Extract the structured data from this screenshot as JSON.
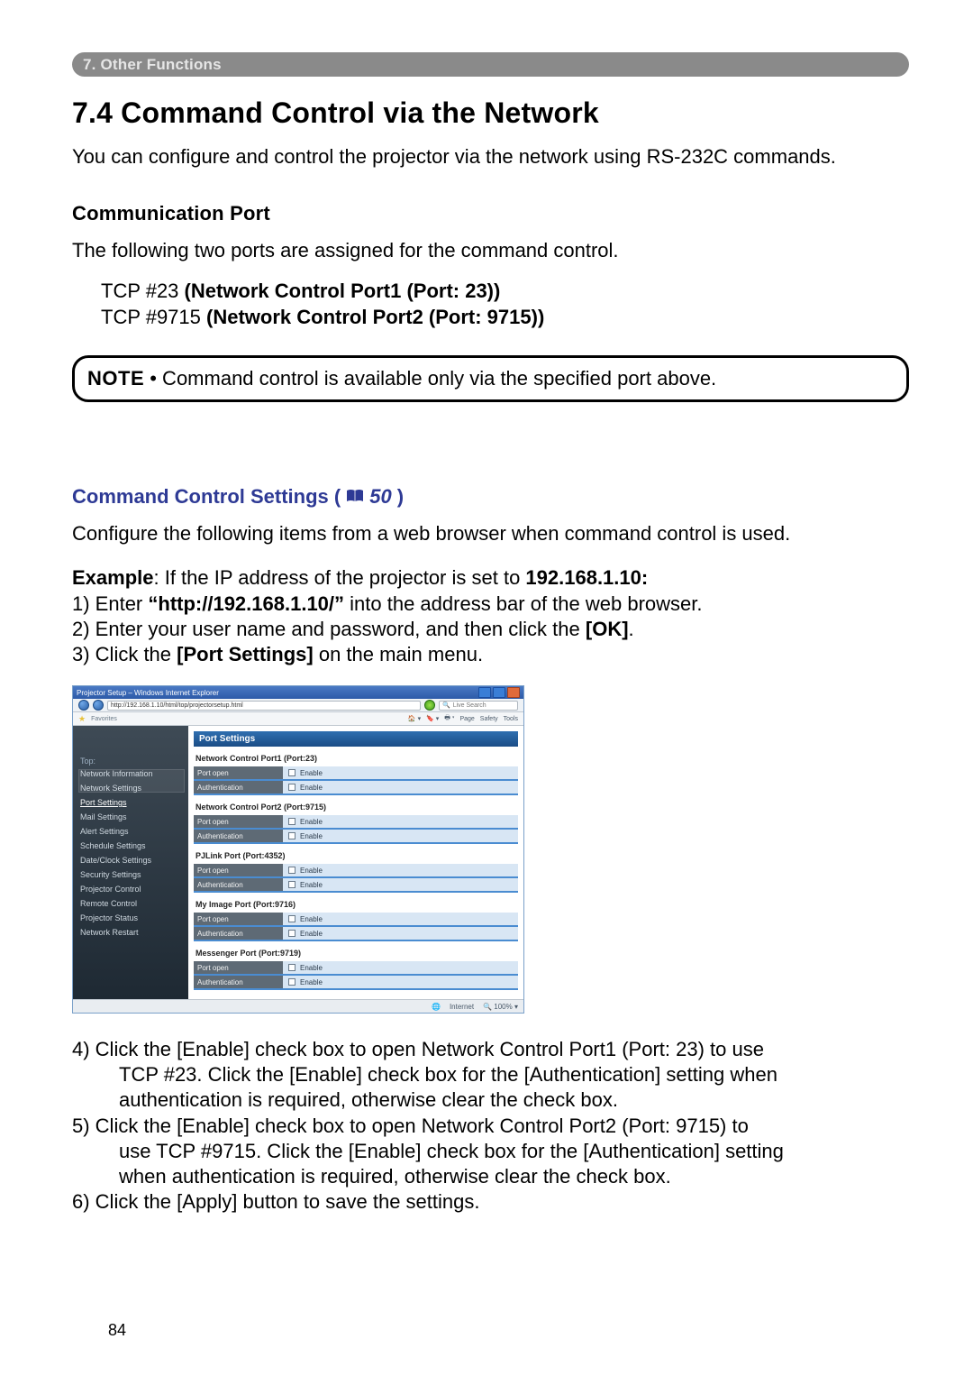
{
  "tab": {
    "label": "7. Other Functions"
  },
  "heading": "7.4 Command Control via the Network",
  "intro": "You can configure and control the projector via the network using RS-232C commands.",
  "comm_port_heading": "Communication Port",
  "comm_port_intro": "The following two ports are assigned for the command control.",
  "port_line1_pre": "TCP #23 ",
  "port_line1_b": "(Network Control Port1 (Port: 23))",
  "port_line2_pre": "TCP #9715 ",
  "port_line2_b": "(Network Control Port2 (Port: 9715))",
  "note_label": "NOTE",
  "note_text": " • Command control is available only via the specified port above.",
  "settings_heading": "Command Control Settings (",
  "settings_ref": "50",
  "settings_heading_close": ")",
  "settings_intro": "Configure the following items from a web browser when command control is used.",
  "example_label": "Example",
  "example_rest": ": If the IP address of the projector is set to ",
  "example_ip": "192.168.1.10:",
  "step1_pre": "1) Enter ",
  "step1_b": "“http://192.168.1.10/”",
  "step1_post": " into the address bar of the web browser.",
  "step2_pre": "2) Enter your user name and password, and then click the ",
  "step2_b": "[OK]",
  "step2_post": ".",
  "step3_pre": "3) Click the ",
  "step3_b": "[Port Settings]",
  "step3_post": " on the main menu.",
  "screenshot": {
    "titlebar": "Projector Setup – Windows Internet Explorer",
    "url": "http://192.168.1.10/html/top/projectorsetup.html",
    "live_search": "Live Search",
    "fav": "Favorites",
    "toolbar_items": [
      "Home",
      "Feeds",
      "Print",
      "Page",
      "Safety",
      "Tools"
    ],
    "side_title": "Top:",
    "side_items": [
      "Network Information",
      "Network Settings",
      "Port Settings",
      "Mail Settings",
      "Alert Settings",
      "Schedule Settings",
      "Date/Clock Settings",
      "Security Settings",
      "Projector Control",
      "Remote Control",
      "Projector Status",
      "Network Restart"
    ],
    "active_index": 2,
    "panel_header": "Port Settings",
    "groups": [
      {
        "title": "Network Control Port1 (Port:23)",
        "rows": [
          {
            "label": "Port open",
            "value": "Enable"
          },
          {
            "label": "Authentication",
            "value": "Enable"
          }
        ]
      },
      {
        "title": "Network Control Port2 (Port:9715)",
        "rows": [
          {
            "label": "Port open",
            "value": "Enable"
          },
          {
            "label": "Authentication",
            "value": "Enable"
          }
        ]
      },
      {
        "title": "PJLink Port (Port:4352)",
        "rows": [
          {
            "label": "Port open",
            "value": "Enable"
          },
          {
            "label": "Authentication",
            "value": "Enable"
          }
        ]
      },
      {
        "title": "My Image Port (Port:9716)",
        "rows": [
          {
            "label": "Port open",
            "value": "Enable"
          },
          {
            "label": "Authentication",
            "value": "Enable"
          }
        ]
      },
      {
        "title": "Messenger Port (Port:9719)",
        "rows": [
          {
            "label": "Port open",
            "value": "Enable"
          },
          {
            "label": "Authentication",
            "value": "Enable"
          }
        ]
      }
    ],
    "footer": {
      "internet": "Internet",
      "zoom": "100%"
    }
  },
  "step4_pre": "4) Click the ",
  "step4_b1": "[Enable]",
  "step4_mid1": " check box to open ",
  "step4_b2": "Network Control Port1 (Port: 23)",
  "step4_mid2": " to use",
  "step4_cont1_pre": "TCP #23. Click the ",
  "step4_cont1_b": "[Enable]",
  "step4_cont1_mid": " check box for the ",
  "step4_cont1_b2": "[Authentication]",
  "step4_cont1_post": " setting when",
  "step4_cont2": "authentication is required, otherwise clear the check box.",
  "step5_pre": "5) Click the ",
  "step5_b1": "[Enable]",
  "step5_mid1": " check box to open ",
  "step5_b2": "Network Control Port2 (Port: 9715)",
  "step5_mid2": " to",
  "step5_cont1_pre": "use TCP #9715. Click the ",
  "step5_cont1_b": "[Enable]",
  "step5_cont1_mid": " check box for the ",
  "step5_cont1_b2": "[Authentication]",
  "step5_cont1_post": " setting",
  "step5_cont2": "when authentication is required, otherwise clear the check box.",
  "step6_pre": "6) Click the ",
  "step6_b": "[Apply]",
  "step6_post": " button to save the settings.",
  "page_number": "84"
}
